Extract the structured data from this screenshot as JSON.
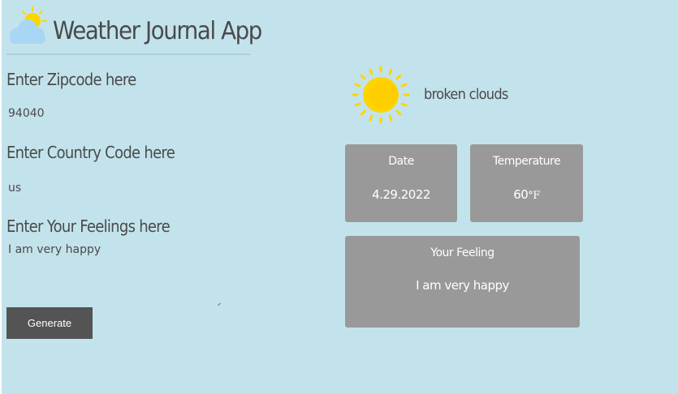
{
  "app": {
    "title": "Weather Journal App"
  },
  "form": {
    "zip_label": "Enter Zipcode here",
    "zip_value": "94040",
    "country_label": "Enter Country Code here",
    "country_value": "us",
    "feelings_label": "Enter Your Feelings here",
    "feelings_value": "I am very happy",
    "generate_label": "Generate"
  },
  "weather": {
    "icon": "sun-icon",
    "description": "broken clouds"
  },
  "cards": {
    "date_head": "Date",
    "date_value": "4.29.2022",
    "temp_head": "Temperature",
    "temp_value": "60",
    "temp_unit": "°F",
    "feeling_head": "Your Feeling",
    "feeling_value": "I am very happy"
  },
  "colors": {
    "background": "#c3e3ec",
    "card": "#999999",
    "button": "#545454",
    "text": "#4a4a4a",
    "sun": "#ffd500"
  }
}
